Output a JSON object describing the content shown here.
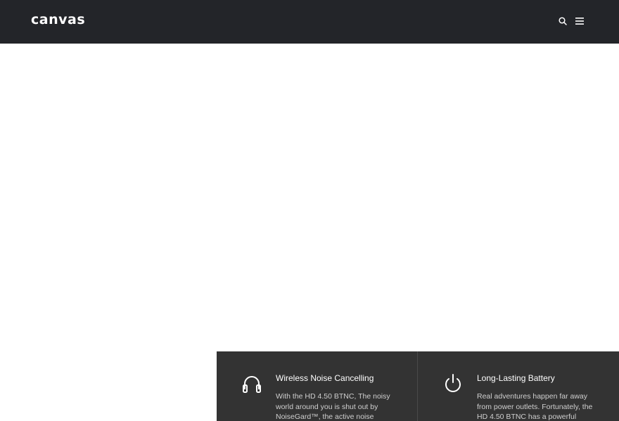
{
  "header": {
    "logo_text": "canvas",
    "search_icon": "search-icon",
    "menu_icon": "menu-icon",
    "background": "#232529"
  },
  "features": [
    {
      "icon": "headphones-icon",
      "title": "Wireless Noise Cancelling",
      "description": "With the HD 4.50 BTNC, The noisy world around you is shut out by NoiseGard™, the active noise"
    },
    {
      "icon": "power-icon",
      "title": "Long-Lasting Battery",
      "description": "Real adventures happen far away from power outlets. Fortunately, the HD 4.50 BTNC has a powerful"
    }
  ],
  "colors": {
    "features_background": "#333333",
    "text_light": "#ffffff"
  }
}
